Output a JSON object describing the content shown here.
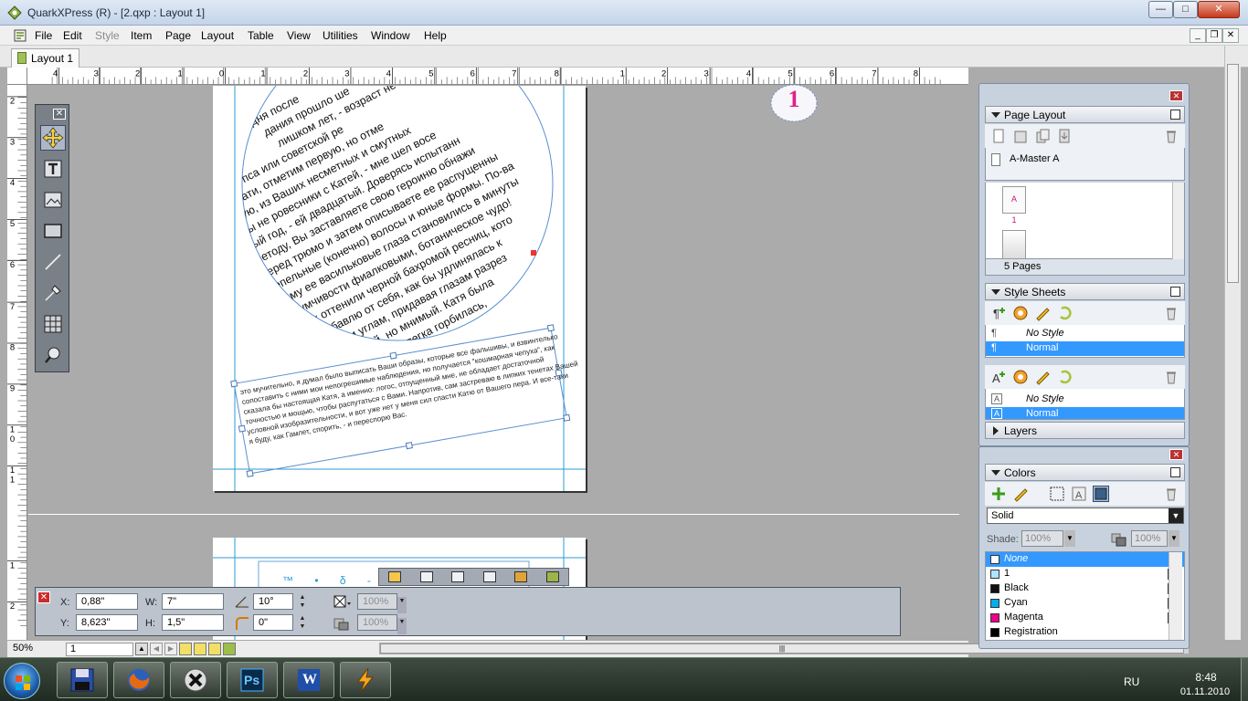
{
  "window": {
    "title": "QuarkXPress (R) - [2.qxp : Layout 1]",
    "minimize": "—",
    "maximize": "□",
    "close": "✕",
    "mdi_minimize": "_",
    "mdi_restore": "❐",
    "mdi_close": "✕"
  },
  "menu": [
    {
      "label": "File",
      "enabled": true
    },
    {
      "label": "Edit",
      "enabled": true
    },
    {
      "label": "Style",
      "enabled": false
    },
    {
      "label": "Item",
      "enabled": true
    },
    {
      "label": "Page",
      "enabled": true
    },
    {
      "label": "Layout",
      "enabled": true
    },
    {
      "label": "Table",
      "enabled": true
    },
    {
      "label": "View",
      "enabled": true
    },
    {
      "label": "Utilities",
      "enabled": true
    },
    {
      "label": "Window",
      "enabled": true
    },
    {
      "label": "Help",
      "enabled": true
    }
  ],
  "tabs": [
    {
      "label": "Layout 1",
      "active": true
    }
  ],
  "ruler": {
    "horizontal_ticks": [
      "4",
      "3",
      "2",
      "1",
      "0",
      "1",
      "2",
      "3",
      "4",
      "5",
      "6",
      "7",
      "8",
      "1",
      "2",
      "3",
      "4",
      "5",
      "6",
      "7",
      "8"
    ],
    "vertical_ticks": [
      "2",
      "3",
      "4",
      "5",
      "6",
      "7",
      "8",
      "9",
      "1 0",
      "1 1",
      "1",
      "2"
    ]
  },
  "document": {
    "circle_text": "дня после... дания прошло ше... лишком лет, - возраст не... рого пса или советской ре... Кстати, отметим первую, но отме... шую, из Ваших несметных и смутных... мы не ровесники с Катей, - мне шел восе... тый год, - ей двадцатый. Доверясь испытанн... методу, Вы заставляете свою героиню обнажи... перед трюмо и затем описываете ее распущенны... пепельные (конечно) волосы и юные формы. По-ва... шему ее васильковые глаза становились в минуты... задумчивости фиалковыми, ботаническое чудо!... Вы их оттенили черной бахромой ресниц, кото... рая, добавлю от себя, как бы удлинялась к... внешним углам, придавая глазам разрез... особенный, но мнимый. Катя была... стройна, но слегка горбилась,... приподнимала плечи, входя в... комнату. Она у Вас",
    "box_text": "это мучительно, я думал было выписать Ваши образы, которые все фальшивы, и взвинтелько сопоставить с ними мои непогрешимые наблюдения, но получается \"кошмарная чепуха\", как сказала бы настоящая Катя, а именно: логос, отпущенный мне, не обладает достаточной точностью и мощью, чтобы распутаться с Вами. Напротив, сам застреваю в липких тенетах Вашей условной изобразительности, и вот уже нет у меня сил спасти Катю от Вашего пера. И все-таки я буду, как Гамлет, спорить, - и переспорю Вас.",
    "page2_text": "™ • δ -",
    "master_badge": "1"
  },
  "measurements": {
    "x_label": "X:",
    "x_value": "0,88\"",
    "y_label": "Y:",
    "y_value": "8,623\"",
    "w_label": "W:",
    "w_value": "7\"",
    "h_label": "H:",
    "h_value": "1,5\"",
    "angle_value": "10°",
    "corner_value": "0\"",
    "opacity1": "100%",
    "opacity2": "100%"
  },
  "status": {
    "zoom": "50%",
    "page": "1"
  },
  "page_layout": {
    "title": "Page Layout",
    "master": "A-Master A",
    "page_thumb_label": "A",
    "page_number": "1",
    "page_count": "5 Pages"
  },
  "style_sheets": {
    "title": "Style Sheets",
    "paragraph": [
      {
        "name": "No Style",
        "selected": false
      },
      {
        "name": "Normal",
        "selected": true
      }
    ],
    "character": [
      {
        "name": "No Style",
        "selected": false
      },
      {
        "name": "Normal",
        "selected": true
      }
    ]
  },
  "layers": {
    "title": "Layers"
  },
  "colors": {
    "title": "Colors",
    "mode": "Solid",
    "shade_label": "Shade:",
    "shade_value": "100%",
    "opacity_value": "100%",
    "items": [
      {
        "name": "None",
        "swatch": "#ffffff",
        "selected": true,
        "cmyk": false
      },
      {
        "name": "1",
        "swatch": "#aee4ff",
        "selected": false,
        "cmyk": true
      },
      {
        "name": "Black",
        "swatch": "#111111",
        "selected": false,
        "cmyk": true
      },
      {
        "name": "Cyan",
        "swatch": "#00aeef",
        "selected": false,
        "cmyk": true
      },
      {
        "name": "Magenta",
        "swatch": "#ec008c",
        "selected": false,
        "cmyk": true
      },
      {
        "name": "Registration",
        "swatch": "#000000",
        "selected": false,
        "cmyk": false
      }
    ]
  },
  "taskbar": {
    "apps": [
      "floppy-app",
      "firefox",
      "cleanup-app",
      "photoshop",
      "word",
      "winamp"
    ],
    "photoshop_label": "Ps",
    "word_label": "W",
    "lang": "RU",
    "time": "8:48",
    "date": "01.11.2010"
  },
  "theme": {
    "selection": "#3399ff",
    "guide": "#2b9ad6",
    "badge": "#e0218a"
  }
}
